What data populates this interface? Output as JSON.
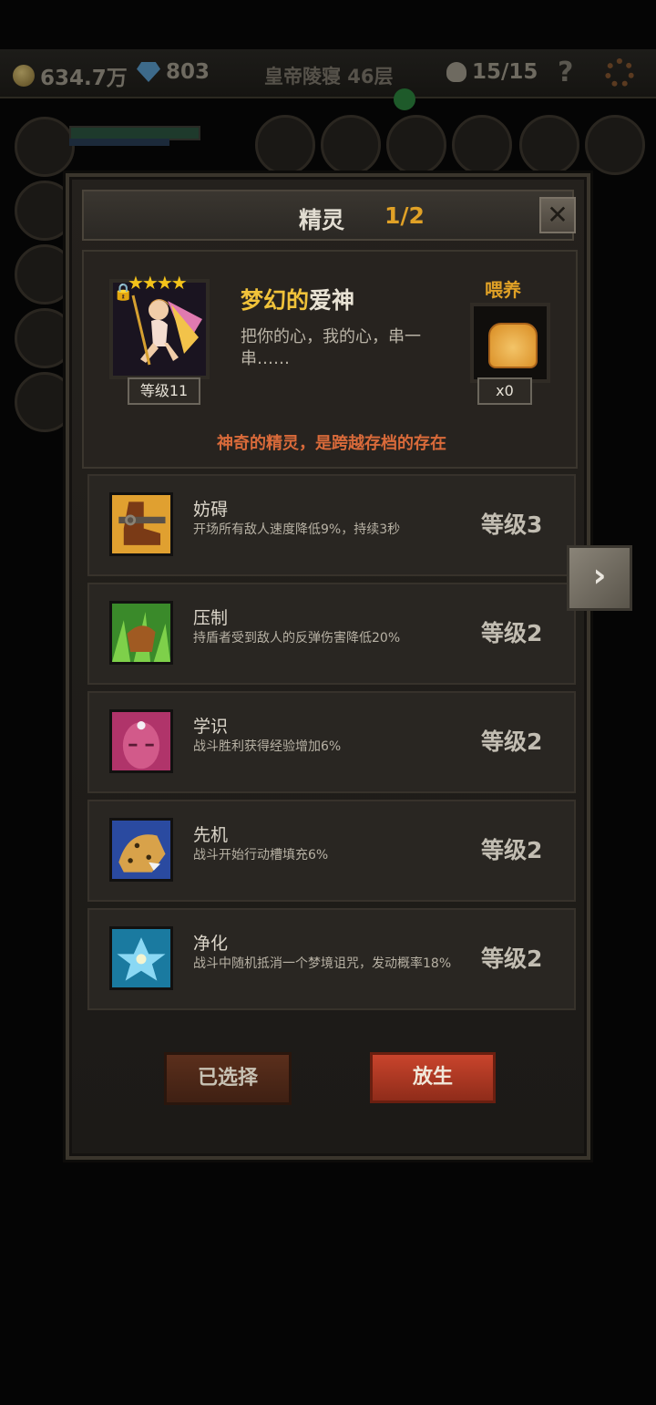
{
  "topbar": {
    "gold": "634.7万",
    "gems": "803",
    "floor": "皇帝陵寝 46层",
    "kills": "15/15",
    "help": "?"
  },
  "panel": {
    "title": "精灵",
    "page": "1/2",
    "close": "✕"
  },
  "spirit": {
    "stars": "★★★★",
    "level_tag": "等级11",
    "name_prefix": "梦幻的",
    "name_suffix": "爱神",
    "description": "把你的心，我的心，串一串……",
    "feed_label": "喂养",
    "feed_count": "x0",
    "tagline": "神奇的精灵，是跨越存档的存在"
  },
  "skills": [
    {
      "name": "妨碍",
      "desc": "开场所有敌人速度降低9%，持续3秒",
      "level": "等级3"
    },
    {
      "name": "压制",
      "desc": "持盾者受到敌人的反弹伤害降低20%",
      "level": "等级2"
    },
    {
      "name": "学识",
      "desc": "战斗胜利获得经验增加6%",
      "level": "等级2"
    },
    {
      "name": "先机",
      "desc": "战斗开始行动槽填充6%",
      "level": "等级2"
    },
    {
      "name": "净化",
      "desc": "战斗中随机抵消一个梦境诅咒，发动概率18%",
      "level": "等级2"
    }
  ],
  "buttons": {
    "selected": "已选择",
    "release": "放生"
  },
  "next": "›",
  "colors": {
    "accent_gold": "#e0a126",
    "tagline_orange": "#d96a3a",
    "release_red": "#c9442c"
  }
}
